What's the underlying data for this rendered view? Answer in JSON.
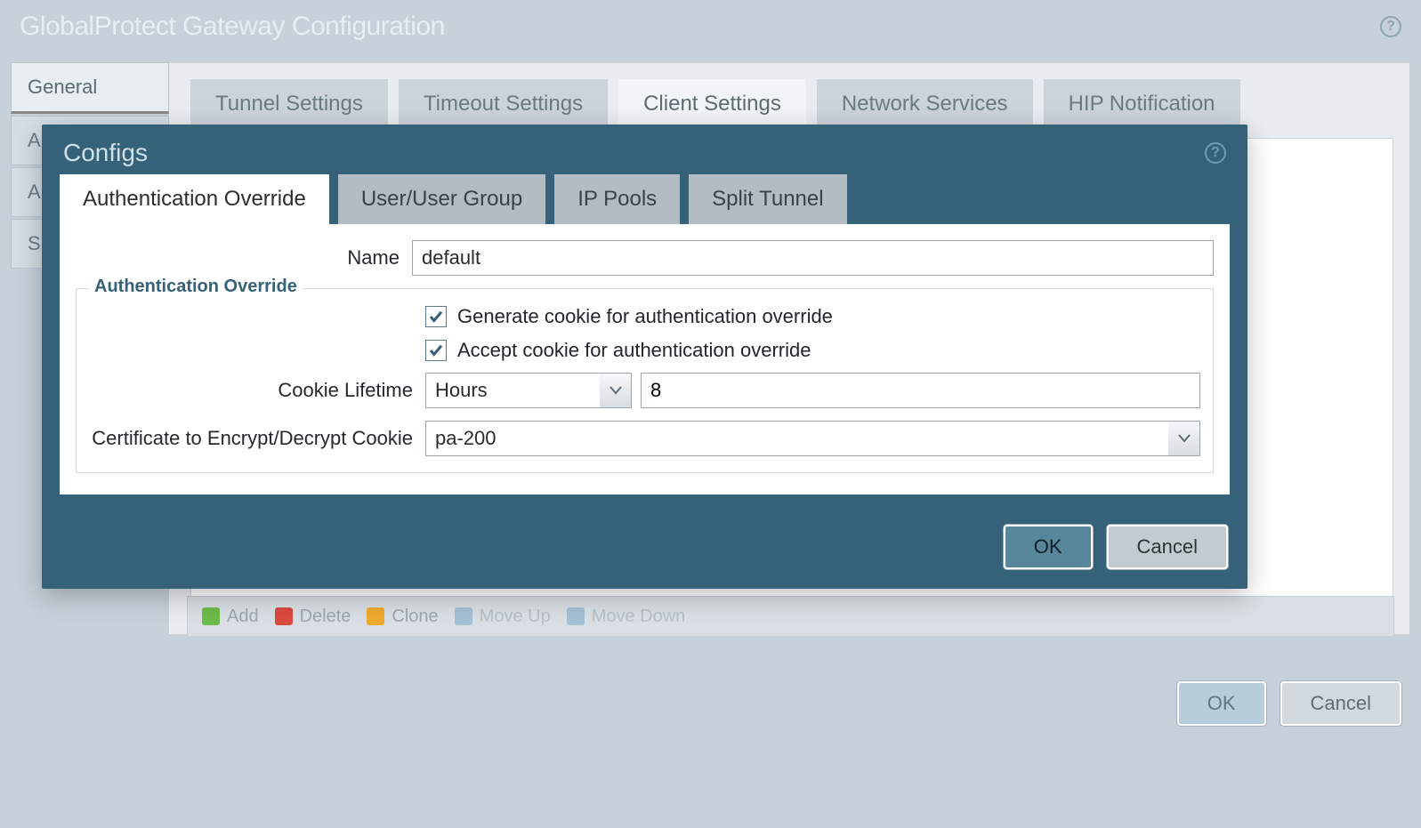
{
  "outer": {
    "title": "GlobalProtect Gateway Configuration",
    "leftTabs": {
      "general": "General",
      "auth_partial": "A",
      "a_partial": "A",
      "s_partial": "S"
    },
    "topTabs": {
      "tunnel": "Tunnel Settings",
      "timeout": "Timeout Settings",
      "client": "Client Settings",
      "network": "Network Services",
      "hip": "HIP Notification"
    },
    "toolbar": {
      "add": "Add",
      "delete": "Delete",
      "clone": "Clone",
      "moveUp": "Move Up",
      "moveDown": "Move Down"
    },
    "buttons": {
      "ok": "OK",
      "cancel": "Cancel"
    }
  },
  "modal": {
    "title": "Configs",
    "tabs": {
      "authOverride": "Authentication Override",
      "userGroup": "User/User Group",
      "ipPools": "IP Pools",
      "splitTunnel": "Split Tunnel"
    },
    "form": {
      "nameLabel": "Name",
      "nameValue": "default",
      "fieldsetTitle": "Authentication Override",
      "generateCookieLabel": "Generate cookie for authentication override",
      "generateCookieChecked": true,
      "acceptCookieLabel": "Accept cookie for authentication override",
      "acceptCookieChecked": true,
      "cookieLifetimeLabel": "Cookie Lifetime",
      "cookieLifetimeUnit": "Hours",
      "cookieLifetimeValue": "8",
      "certLabel": "Certificate to Encrypt/Decrypt Cookie",
      "certValue": "pa-200"
    },
    "buttons": {
      "ok": "OK",
      "cancel": "Cancel"
    }
  }
}
